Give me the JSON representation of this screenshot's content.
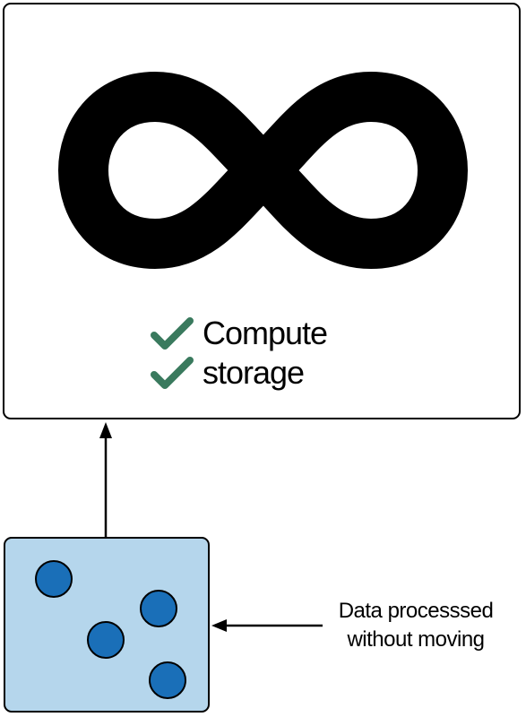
{
  "cloud": {
    "checklist": [
      {
        "label": "Compute",
        "icon": "checkmark-icon"
      },
      {
        "label": "storage",
        "icon": "checkmark-icon"
      }
    ],
    "check_color": "#3a7a5e"
  },
  "data_store": {
    "fill_color": "#b5d6ec",
    "dot_color": "#1a6fb8"
  },
  "annotation": {
    "line1": "Data processsed",
    "line2": "without moving"
  }
}
